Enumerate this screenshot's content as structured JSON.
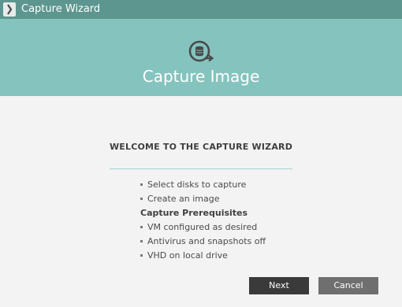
{
  "window": {
    "title": "Capture Wizard",
    "icon": "wizard-app-icon"
  },
  "hero": {
    "icon": "capture-disk-icon",
    "title": "Capture Image"
  },
  "welcome": {
    "heading": "WELCOME TO THE CAPTURE WIZARD"
  },
  "steps": [
    "Select disks to capture",
    "Create an image"
  ],
  "prerequisites": {
    "heading": "Capture Prerequisites",
    "items": [
      "VM configured as desired",
      "Antivirus and snapshots off",
      "VHD on local drive"
    ]
  },
  "buttons": {
    "next_label": "Next",
    "cancel_label": "Cancel"
  },
  "colors": {
    "titlebar": "#5d958f",
    "hero": "#85c3be",
    "background": "#f3f3f3",
    "next_button": "#3a3a3a",
    "cancel_button": "#6f6f6f"
  }
}
